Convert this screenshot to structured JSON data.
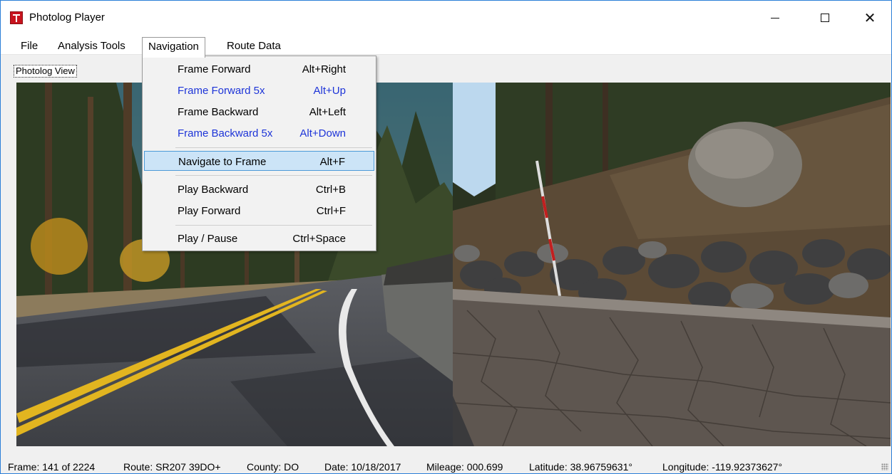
{
  "window": {
    "title": "Photolog Player",
    "controls": {
      "minimize": "minimize-icon",
      "maximize": "maximize-icon",
      "close": "close-icon"
    }
  },
  "menubar": {
    "items": [
      "File",
      "Analysis Tools",
      "Navigation",
      "Route Data"
    ],
    "active": "Navigation"
  },
  "view_tab": {
    "label": "Photolog View"
  },
  "navigation_menu": {
    "items": [
      {
        "label": "Frame Forward",
        "shortcut": "Alt+Right",
        "style": "normal"
      },
      {
        "label": "Frame Forward 5x",
        "shortcut": "Alt+Up",
        "style": "blue"
      },
      {
        "label": "Frame Backward",
        "shortcut": "Alt+Left",
        "style": "normal"
      },
      {
        "label": "Frame Backward 5x",
        "shortcut": "Alt+Down",
        "style": "blue"
      },
      {
        "label": "Navigate to Frame",
        "shortcut": "Alt+F",
        "style": "highlighted"
      },
      {
        "label": "Play Backward",
        "shortcut": "Ctrl+B",
        "style": "normal"
      },
      {
        "label": "Play Forward",
        "shortcut": "Ctrl+F",
        "style": "normal"
      },
      {
        "label": "Play / Pause",
        "shortcut": "Ctrl+Space",
        "style": "normal"
      }
    ]
  },
  "status": {
    "frame": "Frame: 141 of 2224",
    "route": "Route: SR207 39DO+",
    "county": "County: DO",
    "date": "Date: 10/18/2017",
    "mileage": "Mileage: 000.699",
    "latitude": "Latitude: 38.96759631°",
    "longitude": "Longitude: -119.92373627°"
  },
  "colors": {
    "accent_border": "#2b7fd8",
    "menu_highlight": "#cce4f7",
    "menu_highlight_border": "#4c9ad8",
    "shortcut_blue": "#1d34d8",
    "app_icon": "#c8141e"
  }
}
